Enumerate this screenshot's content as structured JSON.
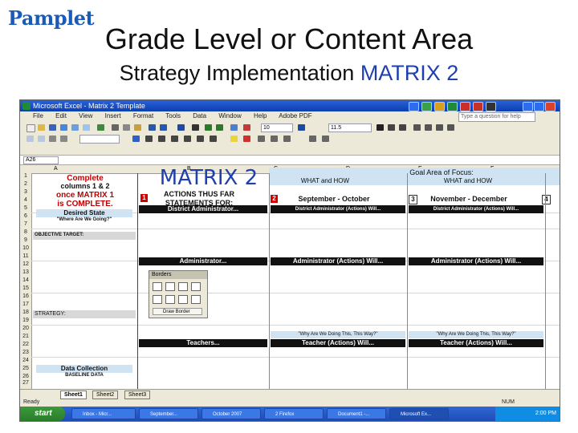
{
  "logo": "Pamplet",
  "title": "Grade Level or Content Area",
  "subtitle_prefix": "Strategy Implementation ",
  "subtitle_accent": "MATRIX 2",
  "excel": {
    "title": "Microsoft Excel - Matrix 2 Template",
    "menu": [
      "File",
      "Edit",
      "View",
      "Insert",
      "Format",
      "Tools",
      "Data",
      "Window",
      "Help",
      "Adobe PDF"
    ],
    "help_placeholder": "Type a question for help",
    "name_box": "A26",
    "font_size": "11.5",
    "zoom": "10",
    "columns": [
      "A",
      "B",
      "C",
      "D",
      "E",
      "F"
    ],
    "rows": [
      "1",
      "2",
      "3",
      "4",
      "5",
      "6",
      "7",
      "8",
      "9",
      "10",
      "11",
      "12",
      "13",
      "14",
      "15",
      "16",
      "17",
      "18",
      "19",
      "20",
      "21",
      "22",
      "23",
      "24",
      "25",
      "26",
      "27",
      "28"
    ]
  },
  "sheet": {
    "complete": "Complete",
    "columns_1_2": "columns 1 & 2",
    "once_matrix": "once MATRIX 1",
    "is_complete": "is COMPLETE.",
    "matrix_label": "MATRIX 2",
    "desired_state": "Desired State",
    "where_going": "\"Where Are We Going?\"",
    "objective_target": "OBJECTIVE TARGET:",
    "strategy": "STRATEGY:",
    "data_collection": "Data Collection",
    "baseline": "BASELINE DATA",
    "actions_thus_far": "ACTIONS THUS FAR",
    "statements_for": "STATEMENTS FOR:",
    "what_how": "WHAT and HOW",
    "goal_area": "Goal Area of Focus:",
    "num1": "1",
    "num2": "2",
    "num3": "3",
    "num4": "4",
    "sep_oct": "September - October",
    "nov_dec": "November - December",
    "district_admin": "District Administrator...",
    "district_admin_will": "District Administrator (Actions) Will...",
    "administrator": "Administrator...",
    "administrator_will": "Administrator (Actions) Will...",
    "why_doing": "\"Why Are We Doing This, This Way?\"",
    "teachers": "Teachers...",
    "teacher_will": "Teacher (Actions) Will..."
  },
  "borders_toolbar": {
    "title": "Borders",
    "draw_border": "Draw Border"
  },
  "sheet_tabs": [
    "Sheet1",
    "Sheet2",
    "Sheet3"
  ],
  "status": {
    "ready": "Ready",
    "num": "NUM"
  },
  "taskbar": {
    "start": "start",
    "tasks": [
      "Inbox - Micr...",
      "September...",
      "October 2007",
      "2 Firefox",
      "Document1 -...",
      "Microsoft Ex..."
    ],
    "clock": "2:00 PM"
  }
}
